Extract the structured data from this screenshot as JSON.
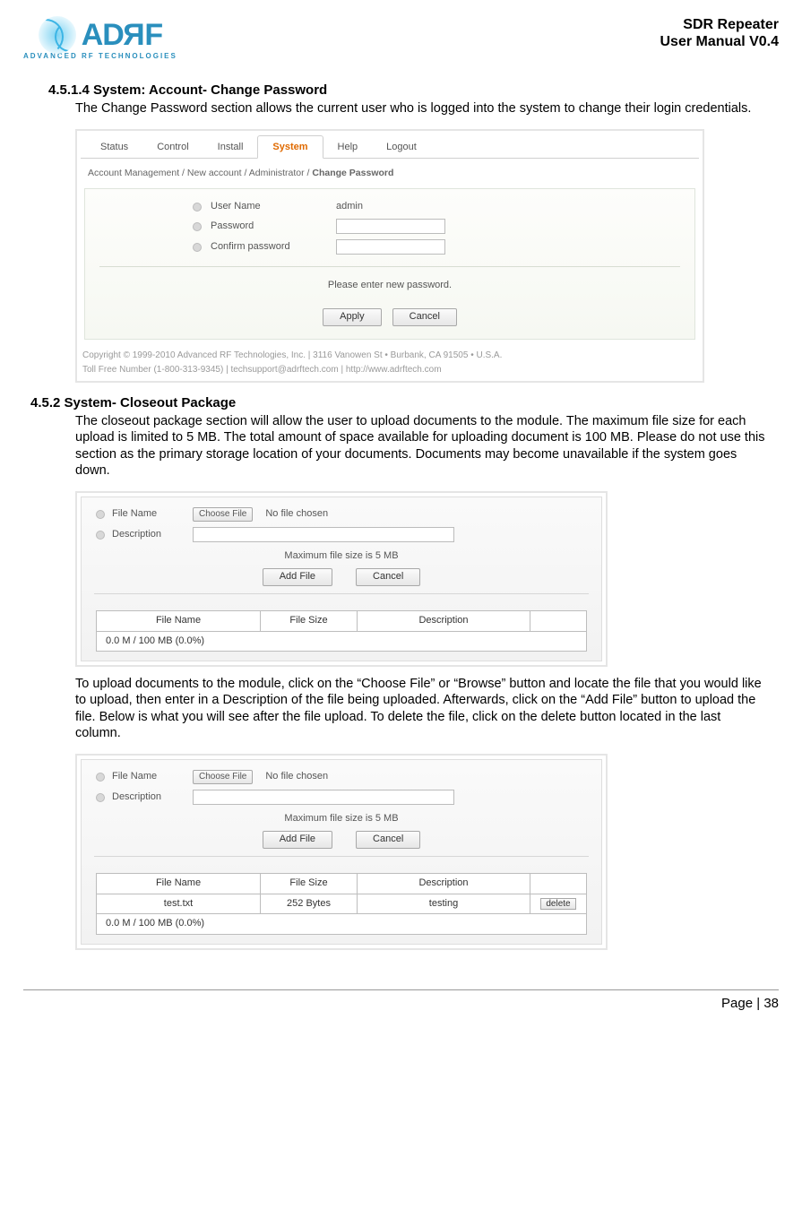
{
  "doc": {
    "title1": "SDR Repeater",
    "title2": "User Manual V0.4",
    "logo_sub": "ADVANCED RF TECHNOLOGIES",
    "logo_text_a": "AD",
    "logo_text_r": "R",
    "logo_text_f": "F",
    "page_prefix": "Page | ",
    "page_num": "38"
  },
  "sec1": {
    "num": "4.5.1.4 System: Account- Change Password",
    "body": "The Change Password section allows the current user who is logged into the system to change their login credentials."
  },
  "tabs": {
    "status": "Status",
    "control": "Control",
    "install": "Install",
    "system": "System",
    "help": "Help",
    "logout": "Logout"
  },
  "bread": {
    "a": "Account Management / New account / Administrator / ",
    "b": "Change Password"
  },
  "form1": {
    "user_lbl": "User Name",
    "user_val": "admin",
    "pwd_lbl": "Password",
    "cpwd_lbl": "Confirm password",
    "msg": "Please enter new password.",
    "apply": "Apply",
    "cancel": "Cancel"
  },
  "copy": {
    "line1": "Copyright © 1999-2010 Advanced RF Technologies, Inc. | 3116 Vanowen St • Burbank, CA 91505 • U.S.A.",
    "line2": "Toll Free Number (1-800-313-9345) | techsupport@adrftech.com | http://www.adrftech.com"
  },
  "sec2": {
    "num": "4.5.2 System- Closeout Package",
    "body": "The closeout package section will allow the user to upload documents to the module.   The maximum file size for each upload is limited to 5 MB.   The total amount of space available for uploading document is 100 MB.   Please do not use this section as the primary storage location of your documents.   Documents may become unavailable if the system goes down."
  },
  "upload": {
    "fn_lbl": "File Name",
    "choose": "Choose File",
    "nofile": "No file chosen",
    "desc_lbl": "Description",
    "hint": "Maximum file size is 5 MB",
    "add": "Add File",
    "cancel": "Cancel"
  },
  "table": {
    "h1": "File Name",
    "h2": "File Size",
    "h3": "Description",
    "storage": "0.0 M / 100 MB (0.0%)"
  },
  "sec3": {
    "body": "To upload documents to the module, click on the “Choose File” or “Browse” button and locate the file that you would like to upload, then enter in a Description of the file being uploaded.   Afterwards, click on the “Add File” button to upload the file.   Below is what you will see after the file upload.   To delete the file, click on the delete button located in the last column."
  },
  "table2": {
    "fn": "test.txt",
    "fs": "252 Bytes",
    "desc": "testing",
    "del": "delete"
  }
}
